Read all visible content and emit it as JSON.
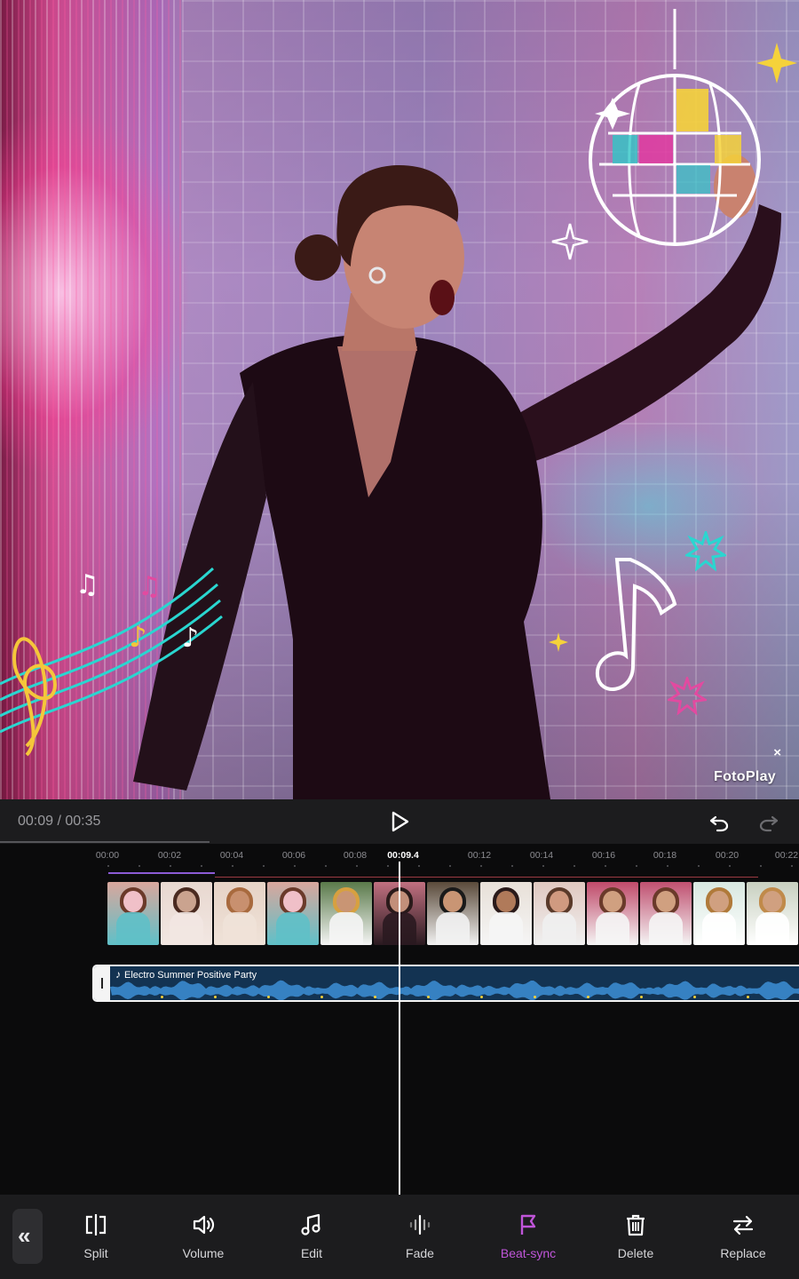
{
  "preview": {
    "watermark": "FotoPlay",
    "watermark_close": "×"
  },
  "player": {
    "timecode": "00:09 / 00:35",
    "icons": [
      "play-icon",
      "undo-icon",
      "redo-icon"
    ]
  },
  "ruler": {
    "labels": [
      "00:00",
      "00:02",
      "00:04",
      "00:06",
      "00:08",
      "00:09.4",
      "00:12",
      "00:14",
      "00:16",
      "00:18",
      "00:20",
      "00:22"
    ],
    "current": "00:09.4"
  },
  "audio": {
    "title": "Electro Summer Positive Party",
    "color": "#133352"
  },
  "toolbar": {
    "collapse_icon": "«",
    "tools": [
      {
        "label": "Split",
        "icon": "split-icon"
      },
      {
        "label": "Volume",
        "icon": "volume-icon"
      },
      {
        "label": "Edit",
        "icon": "music-note-icon"
      },
      {
        "label": "Fade",
        "icon": "fade-icon"
      },
      {
        "label": "Beat-sync",
        "icon": "flag-icon",
        "active": true
      },
      {
        "label": "Delete",
        "icon": "trash-icon"
      },
      {
        "label": "Replace",
        "icon": "swap-icon"
      }
    ]
  },
  "colors": {
    "accent": "#c055d9",
    "playhead": "#ffffff",
    "beat_marker": "#f5d23a",
    "clip_range": "#8c5bd6"
  }
}
